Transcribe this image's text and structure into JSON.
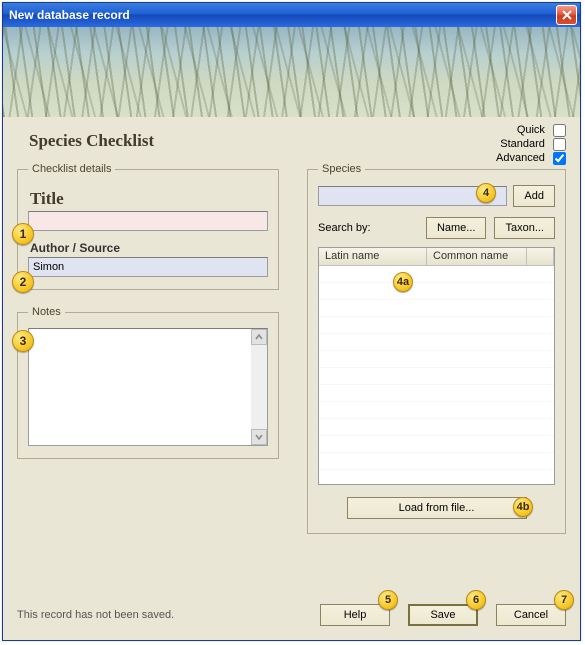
{
  "window": {
    "title": "New database record"
  },
  "heading": "Species Checklist",
  "modes": {
    "quick": {
      "label": "Quick",
      "checked": false
    },
    "standard": {
      "label": "Standard",
      "checked": false
    },
    "advanced": {
      "label": "Advanced",
      "checked": true
    }
  },
  "checklist": {
    "legend": "Checklist details",
    "title_label": "Title",
    "title_value": "",
    "author_label": "Author / Source",
    "author_value": "Simon"
  },
  "notes": {
    "legend": "Notes"
  },
  "species": {
    "legend": "Species",
    "input_value": "",
    "add_label": "Add",
    "search_label": "Search by:",
    "name_btn": "Name...",
    "taxon_btn": "Taxon...",
    "col_latin": "Latin name",
    "col_common": "Common name",
    "load_label": "Load from file..."
  },
  "buttons": {
    "help": "Help",
    "save": "Save",
    "cancel": "Cancel"
  },
  "status": "This record has not been saved.",
  "callouts": {
    "c1": "1",
    "c2": "2",
    "c3": "3",
    "c4": "4",
    "c4a": "4a",
    "c4b": "4b",
    "c5": "5",
    "c6": "6",
    "c7": "7"
  }
}
